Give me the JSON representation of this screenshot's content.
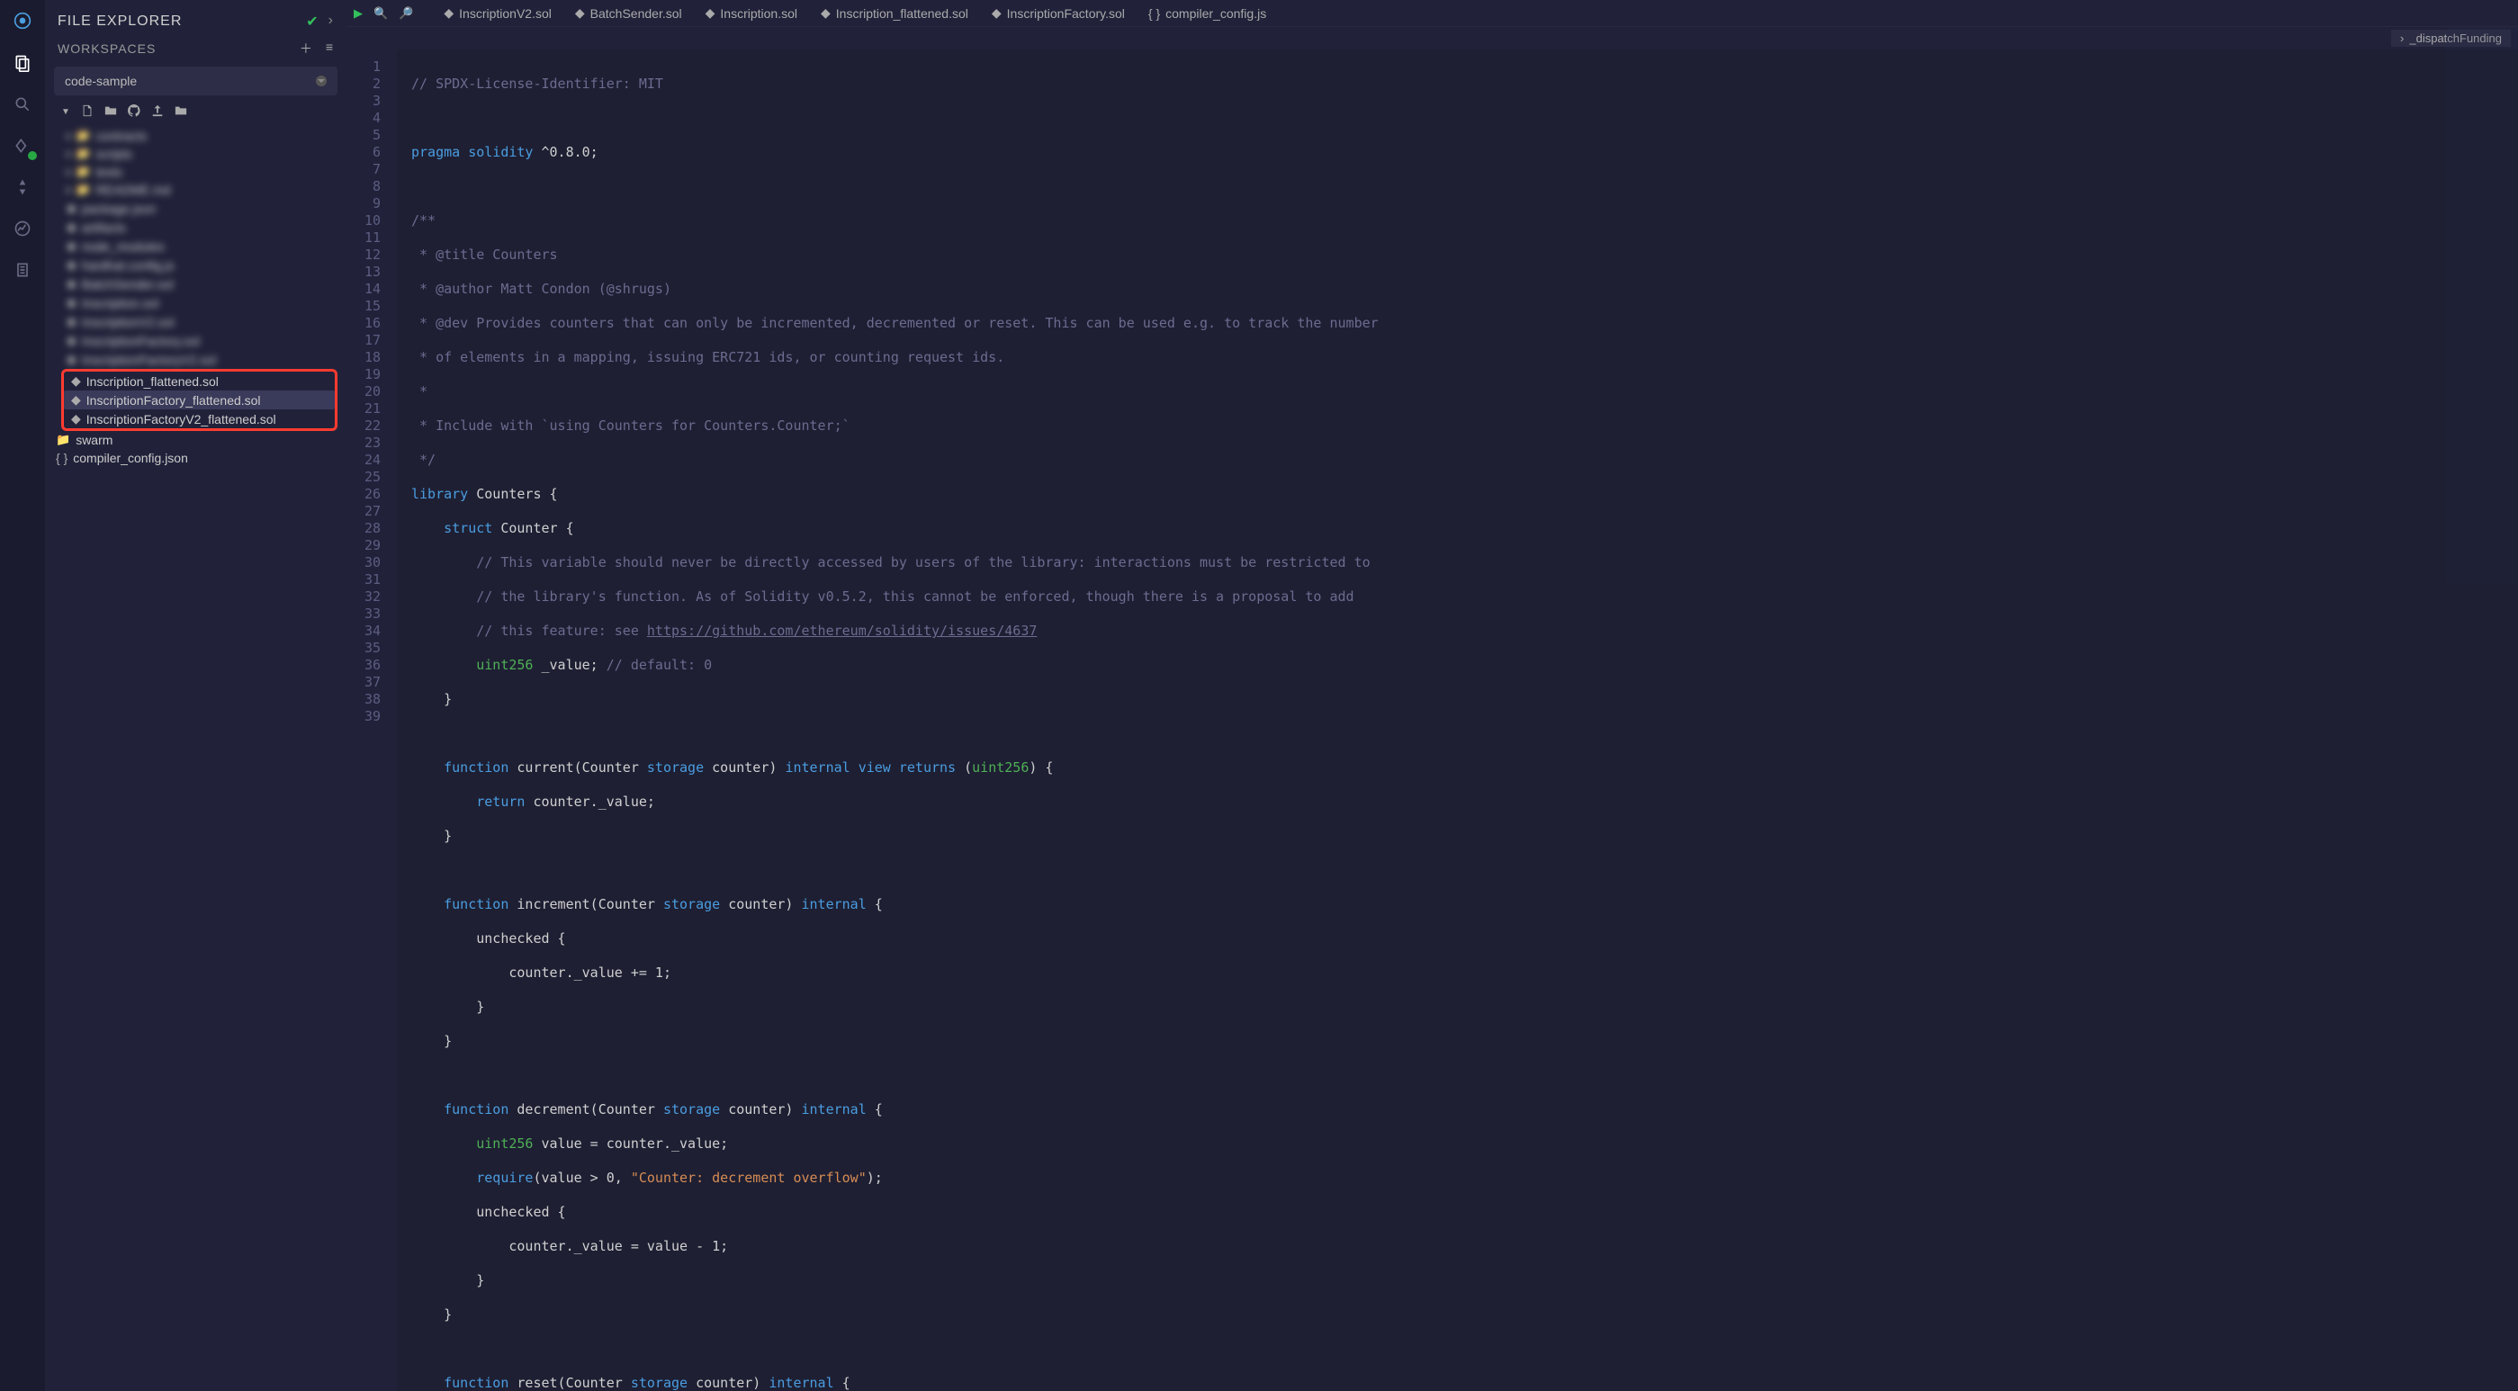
{
  "sidebar": {
    "title": "FILE EXPLORER",
    "workspacesLabel": "WORKSPACES",
    "workspaceSelected": "code-sample"
  },
  "tree": {
    "blurred": [
      "contracts",
      "scripts",
      "tests",
      "README.md",
      "package.json",
      "artifacts",
      "node_modules",
      "hardhat.config.js",
      "BatchSender.sol",
      "Inscription.sol",
      "InscriptionV2.sol",
      "InscriptionFactory.sol",
      "InscriptionFactoryV2.sol"
    ],
    "highlight1": "Inscription_flattened.sol",
    "highlight2": "InscriptionFactory_flattened.sol",
    "highlight3": "InscriptionFactoryV2_flattened.sol",
    "swarm": "swarm",
    "compiler": "compiler_config.json"
  },
  "tabs": [
    {
      "icon": "sol",
      "label": "InscriptionV2.sol"
    },
    {
      "icon": "sol",
      "label": "BatchSender.sol"
    },
    {
      "icon": "sol",
      "label": "Inscription.sol"
    },
    {
      "icon": "sol",
      "label": "Inscription_flattened.sol"
    },
    {
      "icon": "sol",
      "label": "InscriptionFactory.sol"
    },
    {
      "icon": "json",
      "label": "compiler_config.js"
    }
  ],
  "breadcrumb": {
    "name": "_dispatchFunding"
  },
  "code": {
    "l1": "// SPDX-License-Identifier: MIT",
    "l2": "",
    "l3a": "pragma",
    "l3b": "solidity",
    "l3c": "^0.8.0;",
    "l4": "",
    "l5": "/**",
    "l6": " * @title Counters",
    "l7": " * @author Matt Condon (@shrugs)",
    "l8": " * @dev Provides counters that can only be incremented, decremented or reset. This can be used e.g. to track the number",
    "l9": " * of elements in a mapping, issuing ERC721 ids, or counting request ids.",
    "l10": " *",
    "l11": " * Include with `using Counters for Counters.Counter;`",
    "l12": " */",
    "l13a": "library",
    "l13b": " Counters {",
    "l14a": "struct",
    "l14b": " Counter {",
    "l15": "// This variable should never be directly accessed by users of the library: interactions must be restricted to",
    "l16": "// the library's function. As of Solidity v0.5.2, this cannot be enforced, though there is a proposal to add",
    "l17a": "// this feature: see ",
    "l17b": "https://github.com/ethereum/solidity/issues/4637",
    "l18a": "uint256",
    "l18b": " _value; ",
    "l18c": "// default: 0",
    "l19": "}",
    "l21a": "function",
    "l21b": " current(Counter ",
    "l21c": "storage",
    "l21d": " counter) ",
    "l21e": "internal",
    "l21f": " ",
    "l21g": "view",
    "l21h": " ",
    "l21i": "returns",
    "l21j": " (",
    "l21k": "uint256",
    "l21l": ") {",
    "l22a": "return",
    "l22b": " counter._value;",
    "l23": "}",
    "l25a": "function",
    "l25b": " increment(Counter ",
    "l25c": "storage",
    "l25d": " counter) ",
    "l25e": "internal",
    "l25f": " {",
    "l26": "unchecked {",
    "l27": "counter._value += 1;",
    "l28": "}",
    "l29": "}",
    "l31a": "function",
    "l31b": " decrement(Counter ",
    "l31c": "storage",
    "l31d": " counter) ",
    "l31e": "internal",
    "l31f": " {",
    "l32a": "uint256",
    "l32b": " value = counter._value;",
    "l33a": "require",
    "l33b": "(value > 0, ",
    "l33c": "\"Counter: decrement overflow\"",
    "l33d": ");",
    "l34": "unchecked {",
    "l35": "counter._value = value - 1;",
    "l36": "}",
    "l37": "}",
    "l39a": "function",
    "l39b": " reset(Counter ",
    "l39c": "storage",
    "l39d": " counter) ",
    "l39e": "internal",
    "l39f": " {"
  },
  "lineCount": 39
}
